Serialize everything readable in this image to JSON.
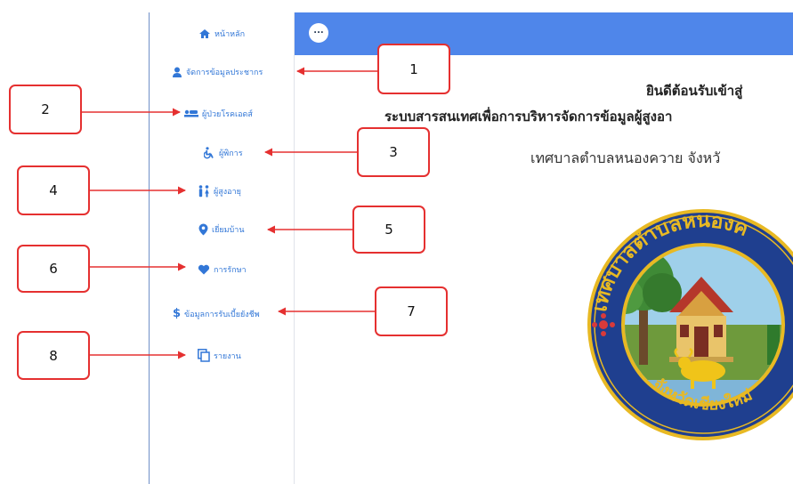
{
  "topbar": {
    "more_label": "..."
  },
  "sidebar": {
    "items": [
      {
        "label": "หน้าหลัก",
        "icon": "home-icon"
      },
      {
        "label": "จัดการข้อมูลประชากร",
        "icon": "user-icon"
      },
      {
        "label": "ผู้ป่วยโรคเอดส์",
        "icon": "patient-bed-icon"
      },
      {
        "label": "ผู้พิการ",
        "icon": "wheelchair-icon"
      },
      {
        "label": "ผู้สูงอายุ",
        "icon": "people-icon"
      },
      {
        "label": "เยี่ยมบ้าน",
        "icon": "map-pin-icon"
      },
      {
        "label": "การรักษา",
        "icon": "heart-icon"
      },
      {
        "label": "ข้อมูลการรับเบี้ยยังชีพ",
        "icon": "dollar-icon"
      },
      {
        "label": "รายงาน",
        "icon": "copy-icon"
      }
    ]
  },
  "main": {
    "welcome": "ยินดีต้อนรับเข้าสู่",
    "system_name": "ระบบสารสนเทศเพื่อการบริหารจัดการข้อมูลผู้สูงอา",
    "municipality": "เทศบาลตำบลหนองควาย จังหวั",
    "seal": {
      "top_text": "เทศบาลตำบลหนองค",
      "bottom_text": "จังหวัดเชียงใหม่"
    }
  },
  "callouts": [
    "1",
    "2",
    "3",
    "4",
    "5",
    "6",
    "7",
    "8"
  ],
  "colors": {
    "topbar": "#4f86ea",
    "nav_text": "#3277d7",
    "callout_red": "#e53030",
    "seal_blue": "#1f3f8f",
    "seal_gold": "#e8b923"
  }
}
